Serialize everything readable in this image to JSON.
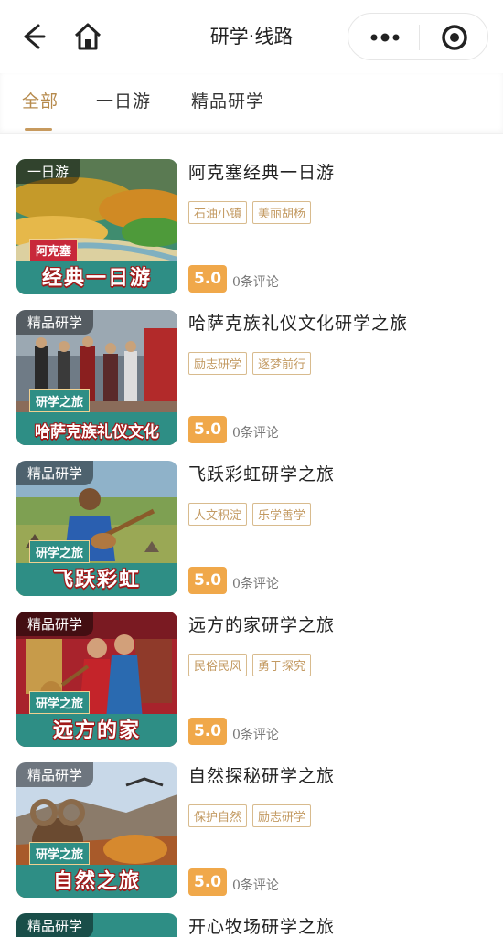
{
  "nav": {
    "title": "研学·线路"
  },
  "tabs": [
    {
      "label": "全部"
    },
    {
      "label": "一日游"
    },
    {
      "label": "精品研学"
    }
  ],
  "items": [
    {
      "title": "阿克塞经典一日游",
      "badge": "一日游",
      "subtag": "阿克塞",
      "banner": "经典一日游",
      "tags": [
        "石油小镇",
        "美丽胡杨"
      ],
      "score": "5.0",
      "reviews": "0条评论"
    },
    {
      "title": "哈萨克族礼仪文化研学之旅",
      "badge": "精品研学",
      "subtag": "研学之旅",
      "banner": "哈萨克族礼仪文化",
      "tags": [
        "励志研学",
        "逐梦前行"
      ],
      "score": "5.0",
      "reviews": "0条评论"
    },
    {
      "title": "飞跃彩虹研学之旅",
      "badge": "精品研学",
      "subtag": "研学之旅",
      "banner": "飞跃彩虹",
      "tags": [
        "人文积淀",
        "乐学善学"
      ],
      "score": "5.0",
      "reviews": "0条评论"
    },
    {
      "title": "远方的家研学之旅",
      "badge": "精品研学",
      "subtag": "研学之旅",
      "banner": "远方的家",
      "tags": [
        "民俗民风",
        "勇于探究"
      ],
      "score": "5.0",
      "reviews": "0条评论"
    },
    {
      "title": "自然探秘研学之旅",
      "badge": "精品研学",
      "subtag": "研学之旅",
      "banner": "自然之旅",
      "tags": [
        "保护自然",
        "励志研学"
      ],
      "score": "5.0",
      "reviews": "0条评论"
    },
    {
      "title": "开心牧场研学之旅",
      "badge": "精品研学"
    }
  ]
}
